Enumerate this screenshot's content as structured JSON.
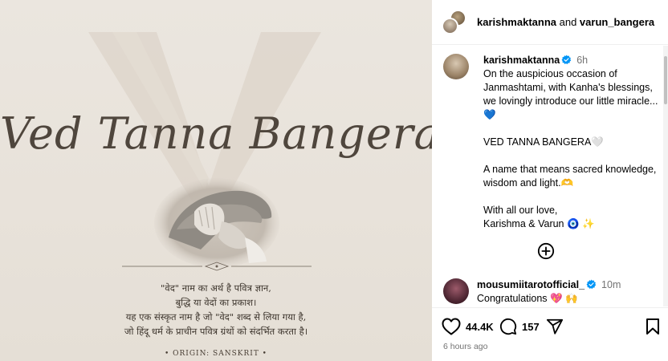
{
  "post_image": {
    "baby_name": "Ved Tanna Bangera",
    "meaning_lines": [
      "\"वेद\" नाम का अर्थ है पवित्र ज्ञान,",
      "बुद्धि या वेदों का प्रकाश।",
      "यह एक संस्कृत नाम है जो \"वेद\" शब्द से लिया गया है,",
      "जो हिंदू धर्म के प्राचीन पवित्र ग्रंथों को संदर्भित करता है।"
    ],
    "origin": "• ORIGIN: SANSKRIT •"
  },
  "header": {
    "user_one": "karishmaktanna",
    "joiner": " and ",
    "user_two": "varun_bangera",
    "more_icon": "more-icon"
  },
  "caption": {
    "username": "karishmaktanna",
    "time": "6h",
    "lines": [
      "On the auspicious occasion of Janmashtami, with Kanha's blessings, we lovingly introduce our little miracle... 💙",
      "",
      "VED TANNA BANGERA🤍",
      "",
      "A name that means sacred knowledge, wisdom and light.🫶",
      "",
      "With all our love,",
      "Karishma & Varun 🧿 ✨"
    ]
  },
  "add_comment_icon": "plus-circle-icon",
  "comment": {
    "username": "mousumiitarotofficial_",
    "time": "10m",
    "text": "Congratulations 💖 🙌"
  },
  "actions": {
    "likes": "44.4K",
    "comments": "157"
  },
  "post_date": "6 hours ago",
  "colors": {
    "verified_blue": "#0095f6",
    "muted_text": "#737373",
    "image_bg": "#e8e2da"
  }
}
